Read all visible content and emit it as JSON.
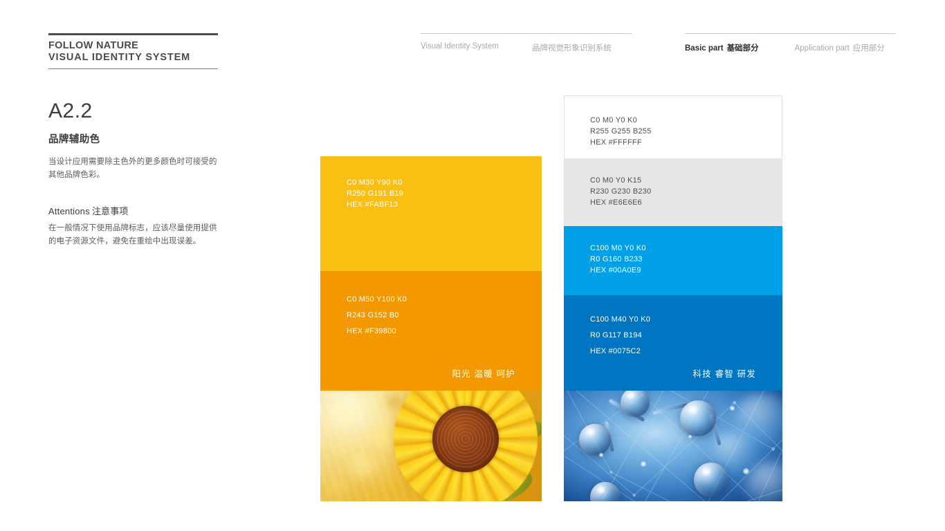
{
  "header": {
    "brand_line1": "FOLLOW NATURE",
    "brand_line2": "VISUAL IDENTITY SYSTEM",
    "nav_left": {
      "en": "Visual Identity System",
      "cn": "品牌视觉形象识别系统"
    },
    "nav_right": {
      "basic_en": "Basic part",
      "basic_cn": "基础部分",
      "application_en": "Application part",
      "application_cn": "应用部分"
    }
  },
  "section": {
    "code": "A2.2",
    "subtitle": "品牌辅助色",
    "body": "当设计应用需要除主色外的更多颜色时可接受的其他品牌色彩。",
    "attentions_en": "Attentions",
    "attentions_cn": "注意事项",
    "attentions_body": "在一般情况下使用品牌标志，应该尽量使用提供的电子资源文件，避免在重绘中出现误差。"
  },
  "palette": {
    "warm": {
      "tagline": "阳光 温暖 呵护",
      "swatches": [
        {
          "cmyk": "C0 M30 Y90 K0",
          "rgb": "R250 G191 B19",
          "hex_label": "HEX #FABF13",
          "hex": "#FABF13",
          "text_color": "#FFFFFF"
        },
        {
          "cmyk": "C0 M50 Y100 K0",
          "rgb": "R243 G152 B0",
          "hex_label": "HEX #F39800",
          "hex": "#F39800",
          "text_color": "#FFFFFF"
        }
      ],
      "photo_name": "sunflower-field-photo"
    },
    "cool": {
      "tagline": "科技 睿智 研发",
      "swatches": [
        {
          "cmyk": "C0 M0 Y0 K0",
          "rgb": "R255 G255 B255",
          "hex_label": "HEX #FFFFFF",
          "hex": "#FFFFFF",
          "text_color": "#4A4F57"
        },
        {
          "cmyk": "C0 M0 Y0 K15",
          "rgb": "R230 G230 B230",
          "hex_label": "HEX #E6E6E6",
          "hex": "#E6E6E6",
          "text_color": "#4A4F57"
        },
        {
          "cmyk": "C100 M0 Y0 K0",
          "rgb": "R0 G160 B233",
          "hex_label": "HEX #00A0E9",
          "hex": "#00A0E9",
          "text_color": "#FFFFFF"
        },
        {
          "cmyk": "C100 M40 Y0 K0",
          "rgb": "R0 G117 B194",
          "hex_label": "HEX #0075C2",
          "hex": "#0075C2",
          "text_color": "#FFFFFF"
        }
      ],
      "photo_name": "molecule-science-photo"
    }
  }
}
